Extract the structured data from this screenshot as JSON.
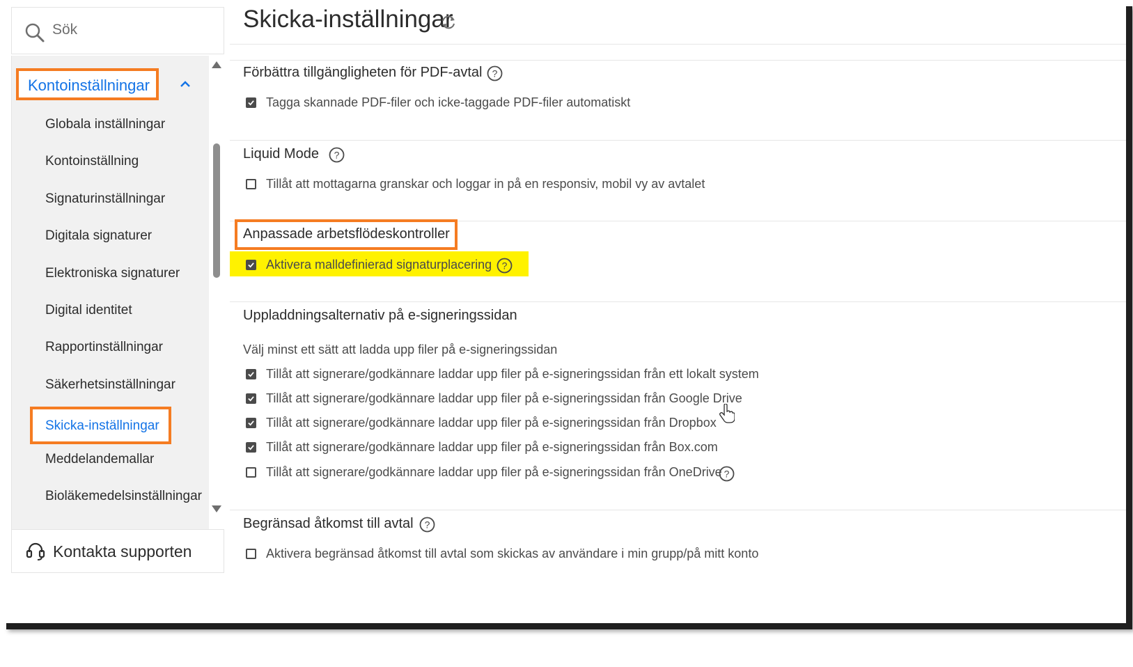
{
  "sidebar": {
    "search": {
      "placeholder": "Sök",
      "icon": "search-icon"
    },
    "header": {
      "label": "Kontoinställningar",
      "icon": "chevron-up-icon"
    },
    "items": [
      {
        "label": "Globala inställningar"
      },
      {
        "label": "Kontoinställning"
      },
      {
        "label": "Signaturinställningar"
      },
      {
        "label": "Digitala signaturer"
      },
      {
        "label": "Elektroniska signaturer"
      },
      {
        "label": "Digital identitet"
      },
      {
        "label": "Rapportinställningar"
      },
      {
        "label": "Säkerhetsinställningar"
      },
      {
        "label": "Skicka-inställningar",
        "active": true
      },
      {
        "label": "Meddelandemallar"
      },
      {
        "label": "Bioläkemedelsinställningar"
      }
    ],
    "support": {
      "label": "Kontakta supporten",
      "icon": "headset-icon"
    }
  },
  "main": {
    "title": "Skicka-inställningar",
    "sections": [
      {
        "title": "Förbättra tillgängligheten för PDF-avtal",
        "options": [
          {
            "label": "Tagga skannade PDF-filer och icke-taggade PDF-filer automatiskt",
            "checked": true
          }
        ]
      },
      {
        "title": "Liquid Mode",
        "options": [
          {
            "label": "Tillåt att mottagarna granskar och loggar in på en responsiv, mobil vy av avtalet",
            "checked": false
          }
        ]
      },
      {
        "title": "Anpassade arbetsflödeskontroller",
        "options": [
          {
            "label": "Aktivera malldefinierad signaturplacering",
            "checked": true
          }
        ]
      },
      {
        "title": "Uppladdningsalternativ på e-signeringssidan",
        "description": "Välj minst ett sätt att ladda upp filer på e-signeringssidan",
        "options": [
          {
            "label": "Tillåt att signerare/godkännare laddar upp filer på e-signeringssidan från ett lokalt system",
            "checked": true
          },
          {
            "label": "Tillåt att signerare/godkännare laddar upp filer på e-signeringssidan från Google Drive",
            "checked": true
          },
          {
            "label": "Tillåt att signerare/godkännare laddar upp filer på e-signeringssidan från Dropbox",
            "checked": true
          },
          {
            "label": "Tillåt att signerare/godkännare laddar upp filer på e-signeringssidan från Box.com",
            "checked": true
          },
          {
            "label": "Tillåt att signerare/godkännare laddar upp filer på e-signeringssidan från OneDrive",
            "checked": false
          }
        ]
      },
      {
        "title": "Begränsad åtkomst till avtal",
        "options": [
          {
            "label": "Aktivera begränsad åtkomst till avtal som skickas av användare i min grupp/på mitt konto",
            "checked": false
          }
        ]
      }
    ]
  },
  "colors": {
    "accent": "#1373e6",
    "highlight_border": "#f57c22",
    "highlight_fill": "#fff200",
    "text": "#2c2c2c"
  }
}
